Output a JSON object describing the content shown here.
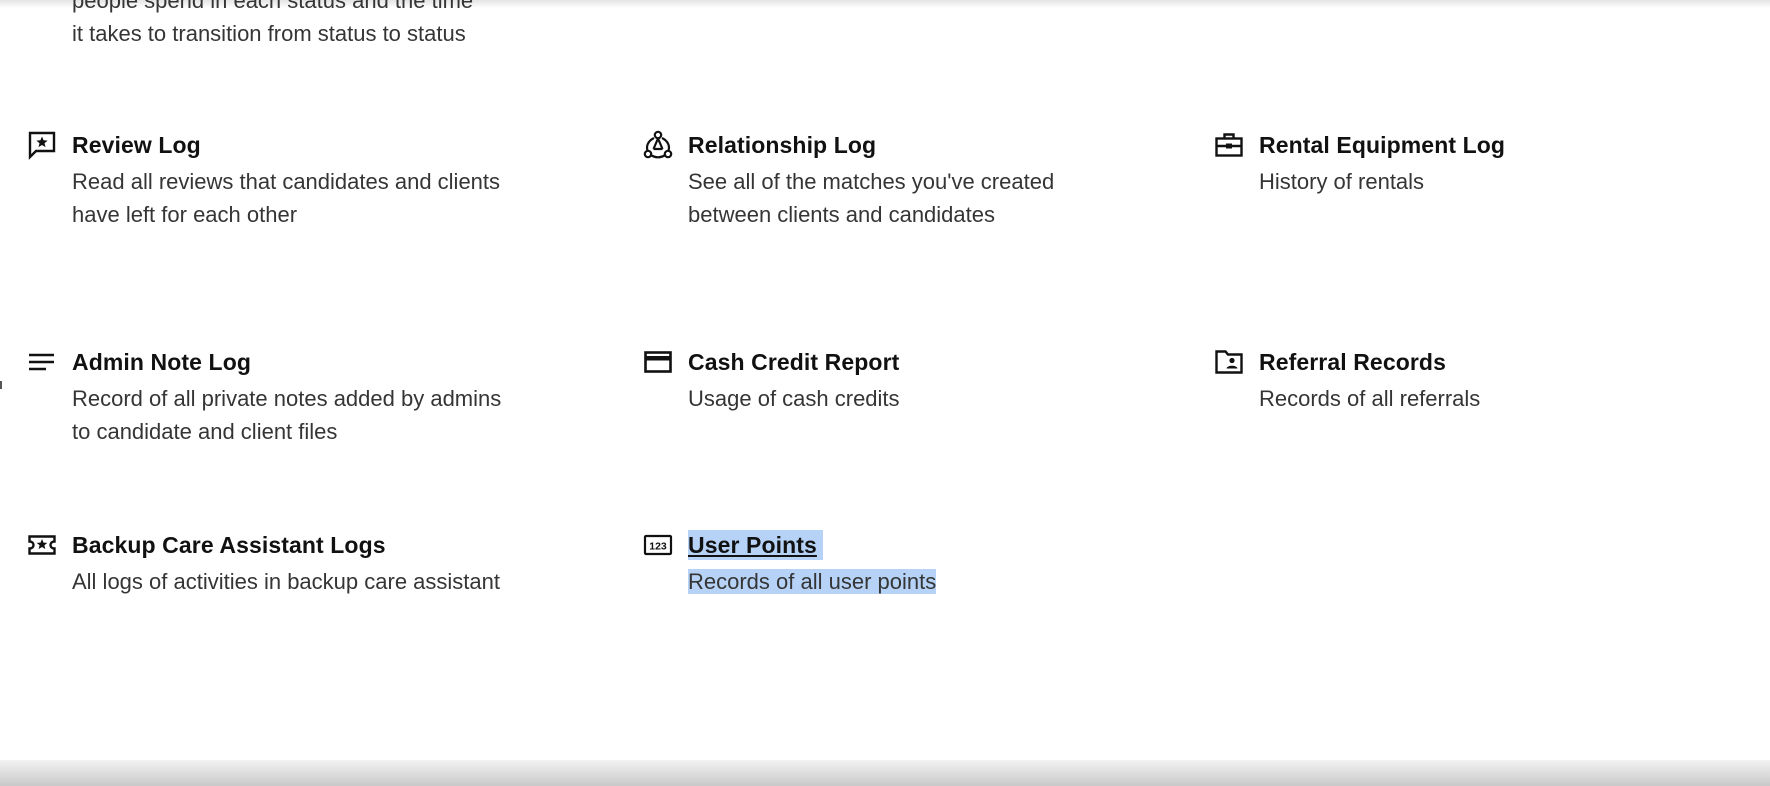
{
  "partial_item": {
    "description_line1": "people spend in each status and the time",
    "description_line2": "it takes to transition from status to status"
  },
  "reports": [
    {
      "title": "Review Log",
      "description": "Read all reviews that candidates and clients have left for each other",
      "icon": "star-comment-icon"
    },
    {
      "title": "Relationship Log",
      "description": "See all of the matches you've created between clients and candidates",
      "icon": "network-icon"
    },
    {
      "title": "Rental Equipment Log",
      "description": "History of rentals",
      "icon": "briefcase-icon"
    },
    {
      "title": "Admin Note Log",
      "description": "Record of all private notes added by admins to candidate and client files",
      "icon": "notes-icon"
    },
    {
      "title": "Cash Credit Report",
      "description": "Usage of cash credits",
      "icon": "credit-card-icon"
    },
    {
      "title": "Referral Records",
      "description": "Records of all referrals",
      "icon": "folder-user-icon"
    },
    {
      "title": "Backup Care Assistant Logs",
      "description": "All logs of activities in backup care assistant",
      "icon": "star-ticket-icon"
    },
    {
      "title": "User Points",
      "description": "Records of all user points",
      "icon": "numeric-123-icon",
      "icon_text": "123",
      "selected": true
    }
  ],
  "colors": {
    "selection": "#b6d3f7",
    "title": "#111111",
    "description": "#353535"
  }
}
